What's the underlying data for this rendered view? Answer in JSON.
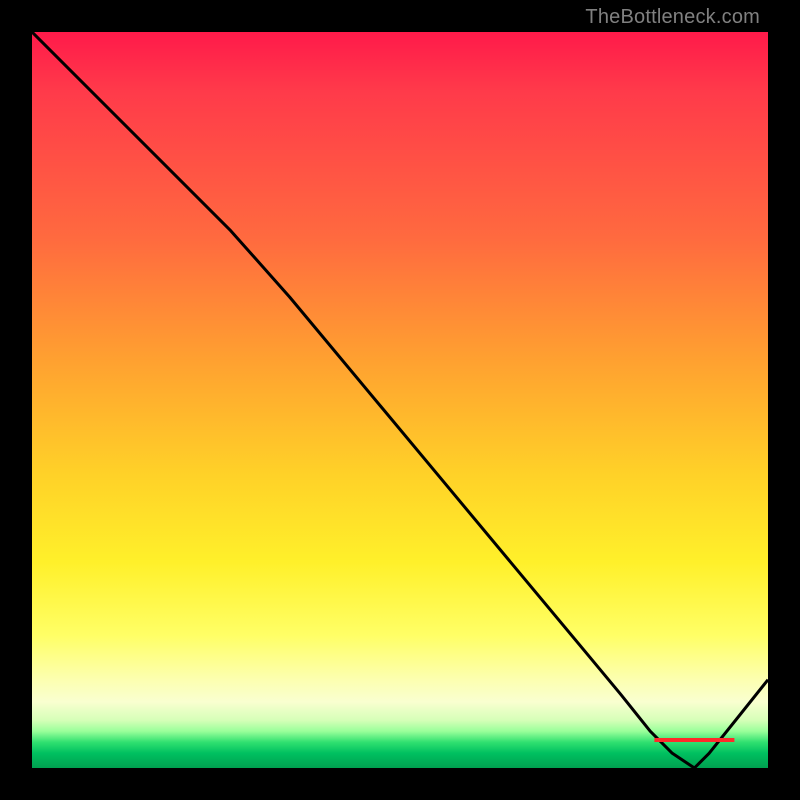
{
  "watermark": "TheBottleneck.com",
  "axis_label_text": "",
  "chart_data": {
    "type": "line",
    "title": "",
    "xlabel": "",
    "ylabel": "",
    "xlim": [
      0,
      100
    ],
    "ylim": [
      0,
      100
    ],
    "series": [
      {
        "name": "curve",
        "x": [
          0,
          5,
          12,
          20,
          27,
          35,
          45,
          55,
          65,
          75,
          80,
          84,
          87,
          90,
          92,
          96,
          100
        ],
        "values": [
          100,
          95,
          88,
          80,
          73,
          64,
          52,
          40,
          28,
          16,
          10,
          5,
          2,
          0,
          2,
          7,
          12
        ]
      }
    ],
    "notch_x": 90,
    "gradient_stops": [
      {
        "pos": 0,
        "color": "#ff1a4a"
      },
      {
        "pos": 45,
        "color": "#ffa230"
      },
      {
        "pos": 82,
        "color": "#ffff66"
      },
      {
        "pos": 96,
        "color": "#30e070"
      },
      {
        "pos": 100,
        "color": "#00a050"
      }
    ]
  }
}
